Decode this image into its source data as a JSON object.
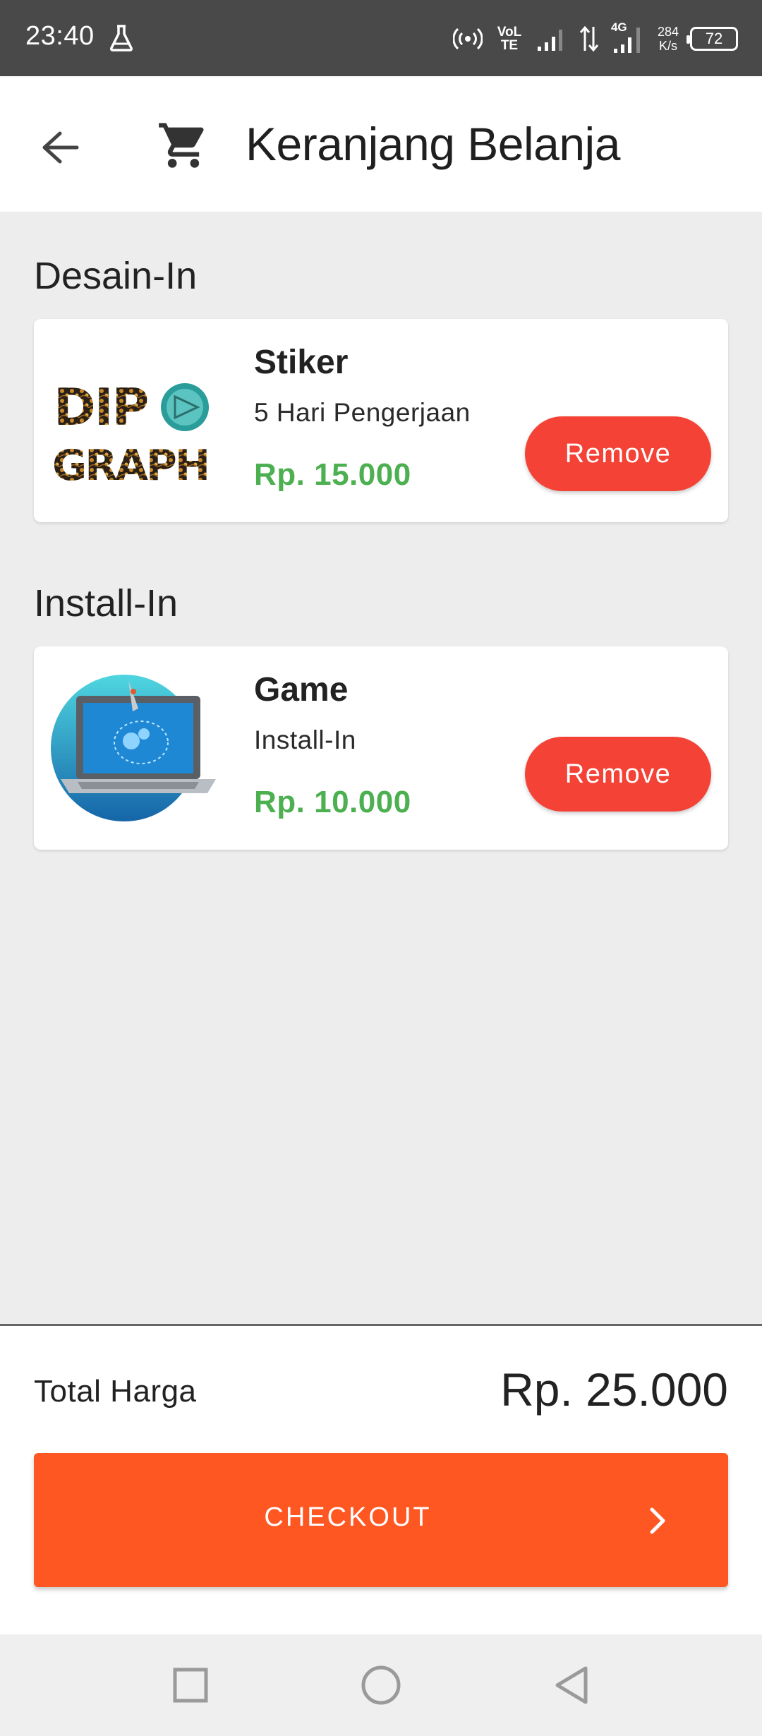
{
  "status_bar": {
    "time": "23:40",
    "network_label": "VoLTE",
    "network_type": "4G",
    "speed_value": "284",
    "speed_unit": "K/s",
    "battery": "72"
  },
  "header": {
    "title": "Keranjang Belanja",
    "back_icon": "arrow-left-icon",
    "cart_icon": "shopping-cart-icon"
  },
  "sections": [
    {
      "title": "Desain-In",
      "item": {
        "name": "Stiker",
        "detail": "5 Hari Pengerjaan",
        "price": "Rp. 15.000",
        "remove_label": "Remove",
        "thumbnail_icon": "dipograph-logo"
      }
    },
    {
      "title": "Install-In",
      "item": {
        "name": "Game",
        "detail": "Install-In",
        "price": "Rp. 10.000",
        "remove_label": "Remove",
        "thumbnail_icon": "laptop-rocket-image"
      }
    }
  ],
  "footer": {
    "total_label": "Total Harga",
    "total_value": "Rp. 25.000",
    "checkout_label": "CHECKOUT"
  },
  "colors": {
    "status_bar": "#4a4949",
    "background": "#ededed",
    "price_green": "#4caf50",
    "remove_red": "#f44336",
    "checkout_orange": "#ff5722"
  }
}
